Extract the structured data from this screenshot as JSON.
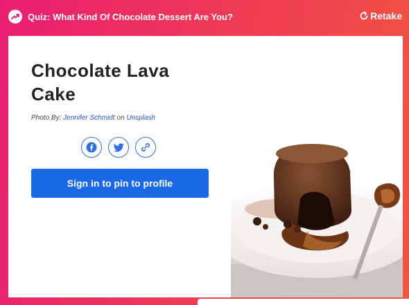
{
  "header": {
    "quiz_title": "Quiz: What Kind Of Chocolate Dessert Are You?",
    "retake_label": "Retake",
    "icon": "trending-icon",
    "retake_icon": "refresh-icon"
  },
  "result": {
    "title": "Chocolate Lava Cake",
    "credit_prefix": "Photo By:",
    "photographer": "Jennifer Schmidt",
    "credit_on": "on",
    "source": "Unsplash"
  },
  "share": {
    "icons": [
      "facebook-icon",
      "twitter-icon",
      "link-icon"
    ]
  },
  "pin_button_label": "Sign in to pin to profile",
  "colors": {
    "accent": "#1a68e6",
    "header_gradient_start": "#e91e72",
    "header_gradient_end": "#f4543f"
  }
}
